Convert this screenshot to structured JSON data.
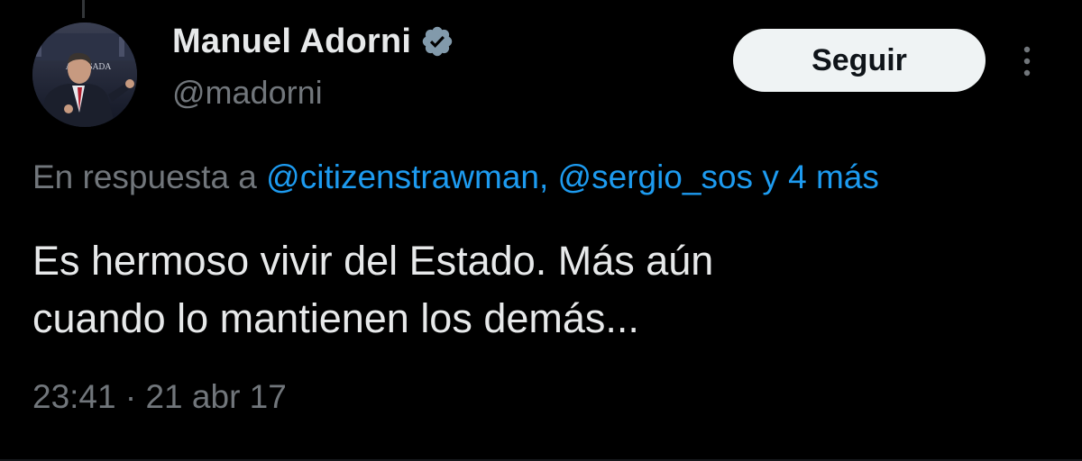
{
  "author": {
    "display_name": "Manuel Adorni",
    "handle": "@madorni",
    "verified_icon": "verified-badge-icon",
    "avatar_sign_text": "A ROSADA"
  },
  "actions": {
    "follow_label": "Seguir",
    "more_icon": "more-vertical-icon"
  },
  "reply": {
    "prefix": "En respuesta a ",
    "mention_1": "@citizenstrawman",
    "separator": ", ",
    "mention_2": "@sergio_sos",
    "suffix": " y 4 más"
  },
  "tweet": {
    "line_1": "Es hermoso vivir del Estado. Más aún",
    "line_2": "cuando lo mantienen los demás..."
  },
  "meta": {
    "time": "23:41",
    "dot": " · ",
    "date": "21 abr 17"
  },
  "colors": {
    "background": "#000000",
    "text_primary": "#e7e9ea",
    "text_secondary": "#71767b",
    "link": "#1d9bf0",
    "button_bg": "#eff3f4",
    "verified_badge": "#829aab"
  }
}
